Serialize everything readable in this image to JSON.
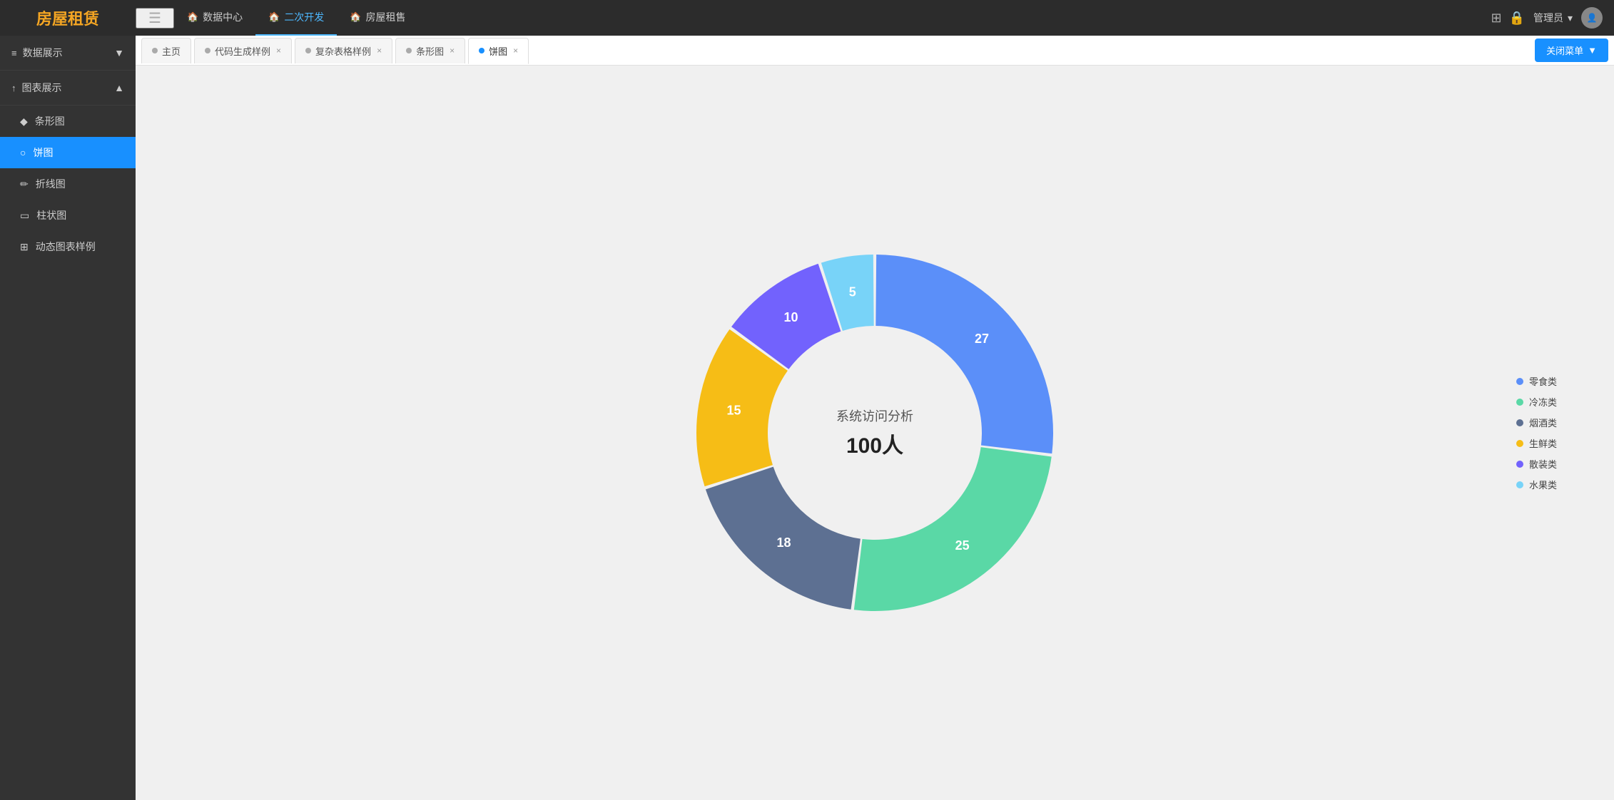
{
  "app": {
    "logo": "房屋租赁",
    "hamburger_icon": "☰"
  },
  "top_nav": {
    "tabs": [
      {
        "id": "data-center",
        "icon": "🏠",
        "label": "数据中心",
        "active": false
      },
      {
        "id": "second-dev",
        "icon": "⚙️",
        "label": "二次开发",
        "active": true
      },
      {
        "id": "house-rent",
        "icon": "⚙️",
        "label": "房屋租售",
        "active": false
      }
    ],
    "admin_label": "管理员",
    "close_menu_label": "关闭菜单",
    "close_menu_arrow": "▼"
  },
  "sidebar": {
    "groups": [
      {
        "id": "data-display",
        "label": "数据展示",
        "icon": "≡",
        "expanded": false,
        "items": []
      },
      {
        "id": "chart-display",
        "label": "图表展示",
        "icon": "↑",
        "expanded": true,
        "items": [
          {
            "id": "bar-chart",
            "icon": "◆",
            "label": "条形图",
            "active": false
          },
          {
            "id": "pie-chart",
            "icon": "○",
            "label": "饼图",
            "active": true
          },
          {
            "id": "line-chart",
            "icon": "✏",
            "label": "折线图",
            "active": false
          },
          {
            "id": "bar-chart2",
            "icon": "▭",
            "label": "柱状图",
            "active": false
          },
          {
            "id": "dynamic-chart",
            "icon": "⊞",
            "label": "动态图表样例",
            "active": false
          }
        ]
      }
    ]
  },
  "tabs_bar": {
    "tabs": [
      {
        "id": "home",
        "label": "主页",
        "dot_color": "#aaa",
        "closable": false,
        "active": false
      },
      {
        "id": "code-gen",
        "label": "代码生成样例",
        "dot_color": "#aaa",
        "closable": true,
        "active": false
      },
      {
        "id": "complex-table",
        "label": "复杂表格样例",
        "dot_color": "#aaa",
        "closable": true,
        "active": false
      },
      {
        "id": "bar-chart",
        "label": "条形图",
        "dot_color": "#aaa",
        "closable": true,
        "active": false
      },
      {
        "id": "pie-chart",
        "label": "饼图",
        "dot_color": "#1890ff",
        "closable": true,
        "active": true
      }
    ],
    "close_menu_label": "关闭菜单",
    "close_menu_arrow": "▼"
  },
  "chart": {
    "title": "系统访问分析",
    "total_label": "100人",
    "segments": [
      {
        "label": "零食类",
        "value": 27,
        "color": "#5b8ff9",
        "startAngle": -90,
        "sweepAngle": 97.2
      },
      {
        "label": "冷冻类",
        "value": 25,
        "color": "#5ad8a6",
        "startAngle": 7.2,
        "sweepAngle": 90
      },
      {
        "label": "烟酒类",
        "value": 18,
        "color": "#5d7092",
        "startAngle": 97.2,
        "sweepAngle": 64.8
      },
      {
        "label": "生鲜类",
        "value": 15,
        "color": "#f6bd16",
        "startAngle": 162,
        "sweepAngle": 54
      },
      {
        "label": "散装类",
        "value": 10,
        "color": "#7262fd",
        "startAngle": 216,
        "sweepAngle": 36
      },
      {
        "label": "水果类",
        "value": 5,
        "color": "#78d3f8",
        "startAngle": 252,
        "sweepAngle": 18
      }
    ],
    "legend": [
      {
        "label": "零食类",
        "color": "#5b8ff9"
      },
      {
        "label": "冷冻类",
        "color": "#5ad8a6"
      },
      {
        "label": "烟酒类",
        "color": "#5d7092"
      },
      {
        "label": "生鲜类",
        "color": "#f6bd16"
      },
      {
        "label": "散装类",
        "color": "#7262fd"
      },
      {
        "label": "水果类",
        "color": "#78d3f8"
      }
    ]
  }
}
